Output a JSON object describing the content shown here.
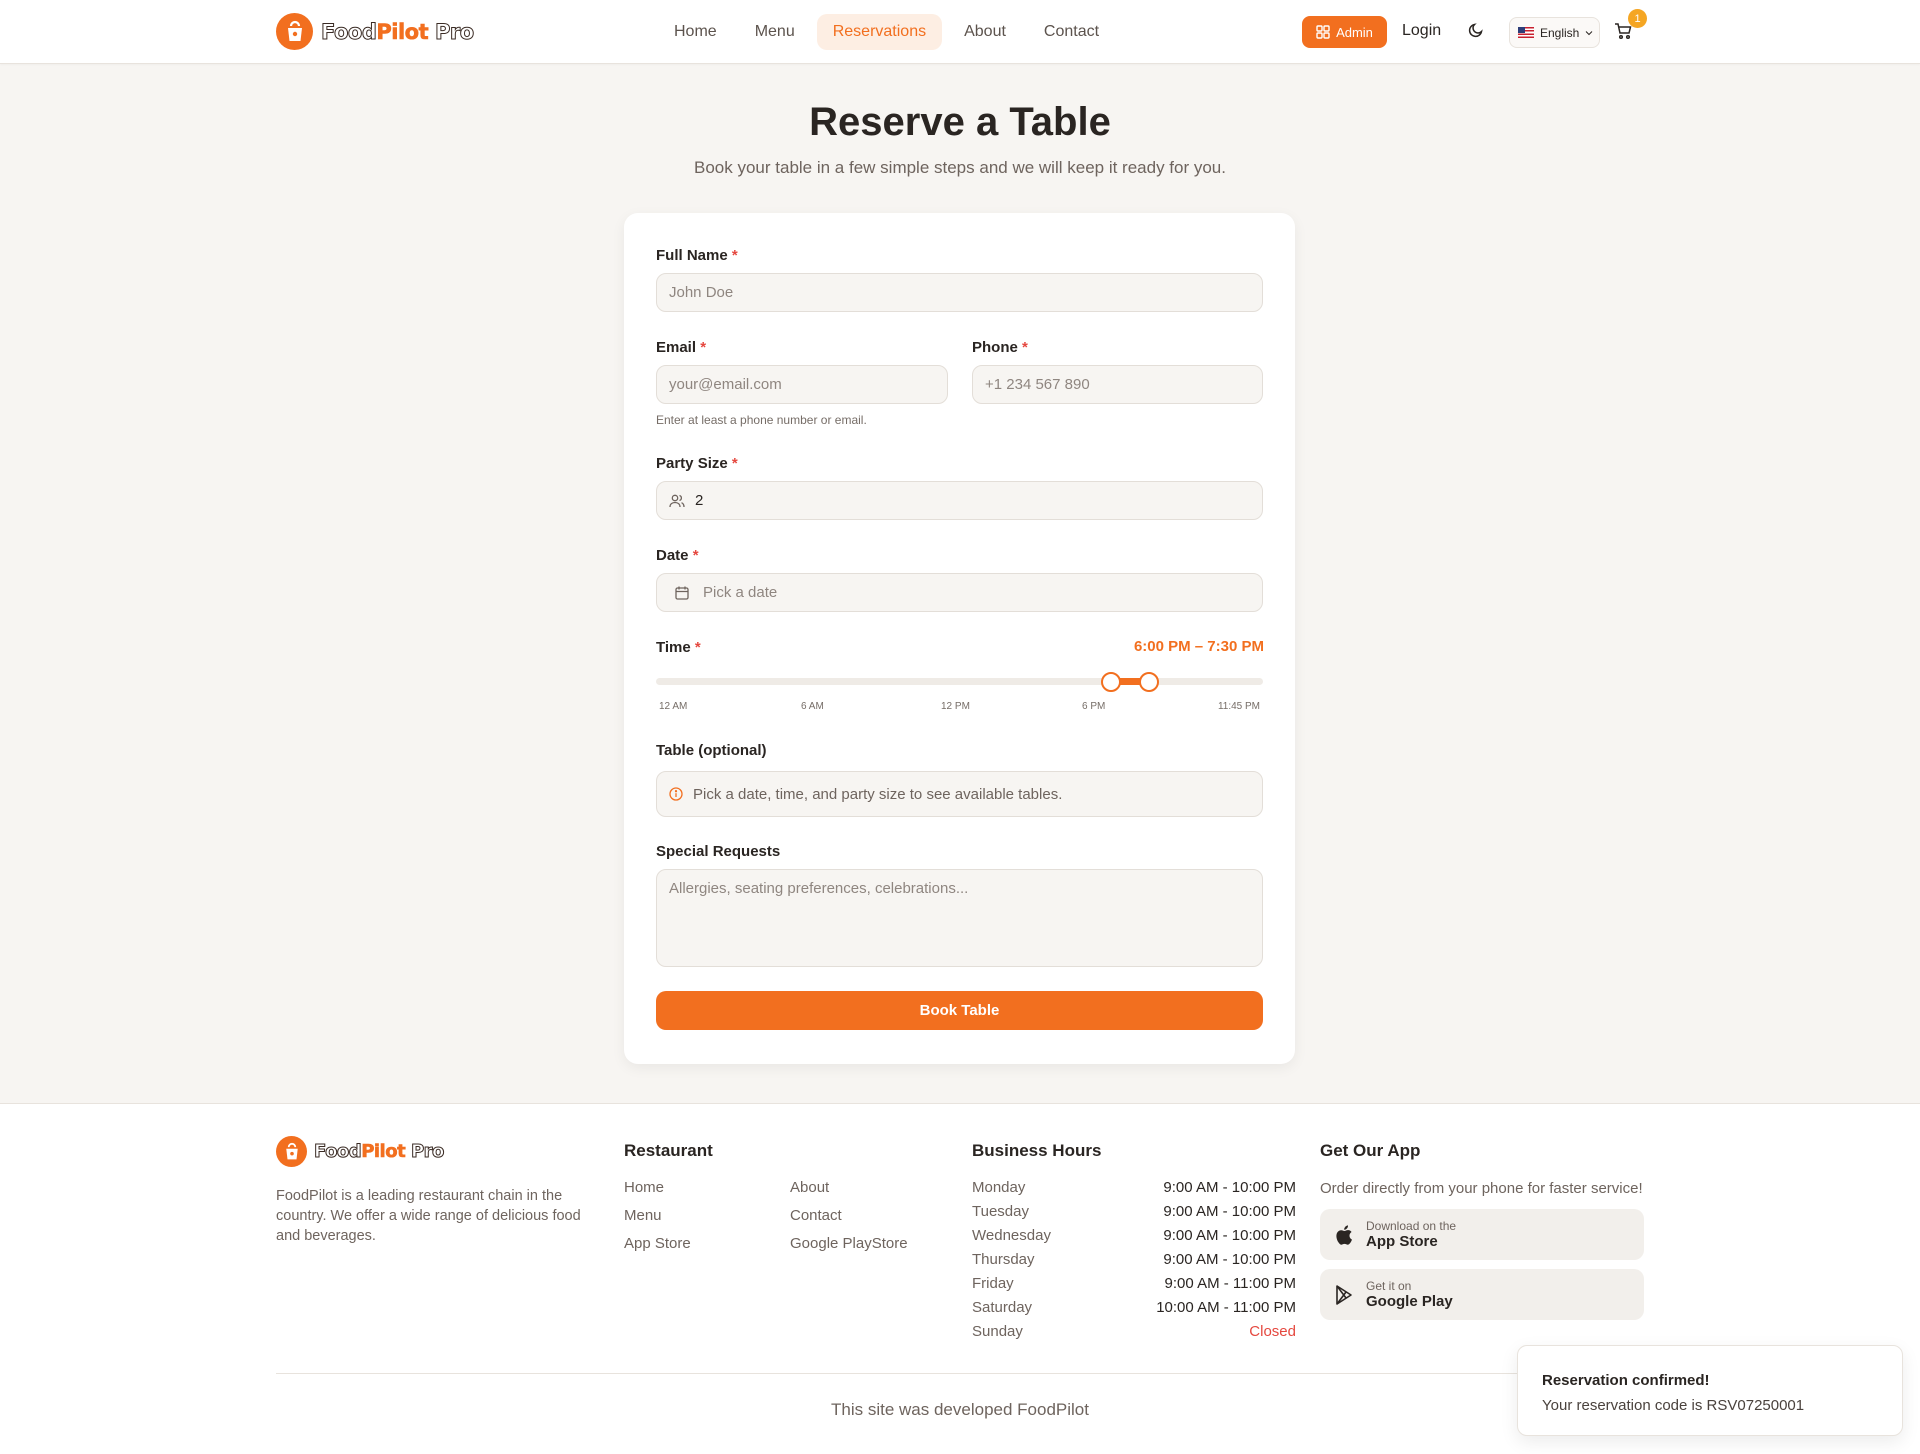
{
  "brand": {
    "name_part1": "Food",
    "name_part2": "Pilot",
    "name_part3": " Pro",
    "accent": "#f26f1f"
  },
  "nav": {
    "items": [
      {
        "label": "Home"
      },
      {
        "label": "Menu"
      },
      {
        "label": "Reservations",
        "active": true
      },
      {
        "label": "About"
      },
      {
        "label": "Contact"
      }
    ],
    "admin_label": "Admin",
    "login_label": "Login",
    "language": "English",
    "cart_count": "1"
  },
  "page": {
    "title": "Reserve a Table",
    "subtitle": "Book your table in a few simple steps and we will keep it ready for you."
  },
  "form": {
    "full_name": {
      "label": "Full Name",
      "placeholder": "John Doe"
    },
    "email": {
      "label": "Email",
      "placeholder": "your@email.com"
    },
    "phone": {
      "label": "Phone",
      "placeholder": "+1 234 567 890"
    },
    "contact_hint": "Enter at least a phone number or email.",
    "party_size": {
      "label": "Party Size",
      "value": "2"
    },
    "date": {
      "label": "Date",
      "placeholder": "Pick a date"
    },
    "time": {
      "label": "Time",
      "range_text": "6:00 PM – 7:30 PM",
      "start_fraction": 0.75,
      "end_fraction": 0.812,
      "ticks": [
        "12 AM",
        "6 AM",
        "12 PM",
        "6 PM",
        "11:45 PM"
      ]
    },
    "table": {
      "label": "Table (optional)",
      "info": "Pick a date, time, and party size to see available tables."
    },
    "special_requests": {
      "label": "Special Requests",
      "placeholder": "Allergies, seating preferences, celebrations..."
    },
    "submit_label": "Book Table",
    "required_mark": "*"
  },
  "footer": {
    "description": "FoodPilot is a leading restaurant chain in the country. We offer a wide range of delicious food and beverages.",
    "restaurant": {
      "heading": "Restaurant",
      "links_col1": [
        "Home",
        "Menu",
        "App Store"
      ],
      "links_col2": [
        "About",
        "Contact",
        "Google PlayStore"
      ]
    },
    "hours": {
      "heading": "Business Hours",
      "rows": [
        {
          "day": "Monday",
          "time": "9:00 AM - 10:00 PM"
        },
        {
          "day": "Tuesday",
          "time": "9:00 AM - 10:00 PM"
        },
        {
          "day": "Wednesday",
          "time": "9:00 AM - 10:00 PM"
        },
        {
          "day": "Thursday",
          "time": "9:00 AM - 10:00 PM"
        },
        {
          "day": "Friday",
          "time": "9:00 AM - 11:00 PM"
        },
        {
          "day": "Saturday",
          "time": "10:00 AM - 11:00 PM"
        },
        {
          "day": "Sunday",
          "time": "Closed"
        }
      ]
    },
    "app": {
      "heading": "Get Our App",
      "description": "Order directly from your phone for faster service!",
      "app_store": {
        "small": "Download on the",
        "big": "App Store"
      },
      "google_play": {
        "small": "Get it on",
        "big": "Google Play"
      }
    },
    "credit": "This site was developed FoodPilot"
  },
  "toast": {
    "title": "Reservation confirmed!",
    "body": "Your reservation code is RSV07250001"
  }
}
